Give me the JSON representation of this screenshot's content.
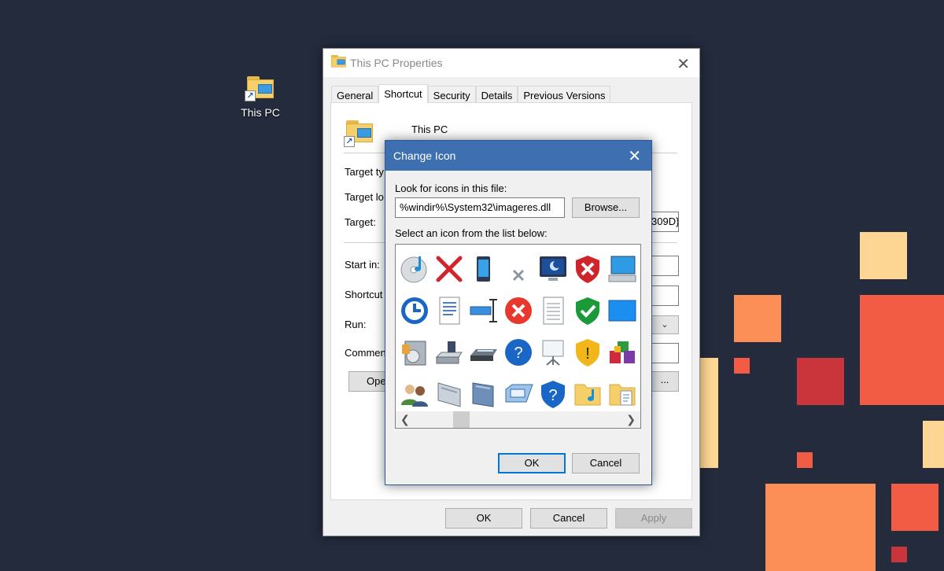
{
  "desktop": {
    "icon_label": "This PC",
    "colors": {
      "background": "#242b3d",
      "accent_red": "#f25c44",
      "accent_orange": "#fc8f58",
      "accent_yellow": "#fcd692",
      "dark_red": "#c9353a"
    }
  },
  "properties_window": {
    "title": "This PC Properties",
    "close_glyph": "✕",
    "tabs": [
      {
        "label": "General"
      },
      {
        "label": "Shortcut"
      },
      {
        "label": "Security"
      },
      {
        "label": "Details"
      },
      {
        "label": "Previous Versions"
      }
    ],
    "active_tab": "Shortcut",
    "shortcut_name": "This PC",
    "fields": {
      "target_type": "Target ty",
      "target_location": "Target lo",
      "target": "Target:",
      "target_value_visible": "309D}",
      "start_in": "Start in:",
      "shortcut_key": "Shortcut",
      "run": "Run:",
      "comment": "Commen"
    },
    "open_button_visible": "Ope",
    "change_icon_button_visible": "...",
    "footer": {
      "ok": "OK",
      "cancel": "Cancel",
      "apply": "Apply"
    }
  },
  "change_icon_dialog": {
    "title": "Change Icon",
    "close_glyph": "✕",
    "look_label": "Look for icons in this file:",
    "file_value": "%windir%\\System32\\imageres.dll",
    "browse_label": "Browse...",
    "select_label": "Select an icon from the list below:",
    "ok_label": "OK",
    "cancel_label": "Cancel",
    "icons": [
      "cd-music-icon",
      "red-x-icon",
      "phone-device-icon",
      "small-x-icon",
      "monitor-moon-icon",
      "shield-x-icon",
      "computer-icon",
      "clock-arrow-icon",
      "document-lines-icon",
      "text-cursor-icon",
      "error-circle-icon",
      "blank-document-icon",
      "shield-check-icon",
      "blue-screen-icon",
      "media-drive-icon",
      "floppy-drive-icon",
      "scanner-icon",
      "help-circle-icon",
      "projector-screen-icon",
      "shield-warning-icon",
      "blocks-icon",
      "users-icon",
      "drive-bay-icon",
      "drive-folder-icon",
      "card-icon",
      "help-shield-icon",
      "music-folder-icon",
      "document-folder-icon"
    ]
  }
}
